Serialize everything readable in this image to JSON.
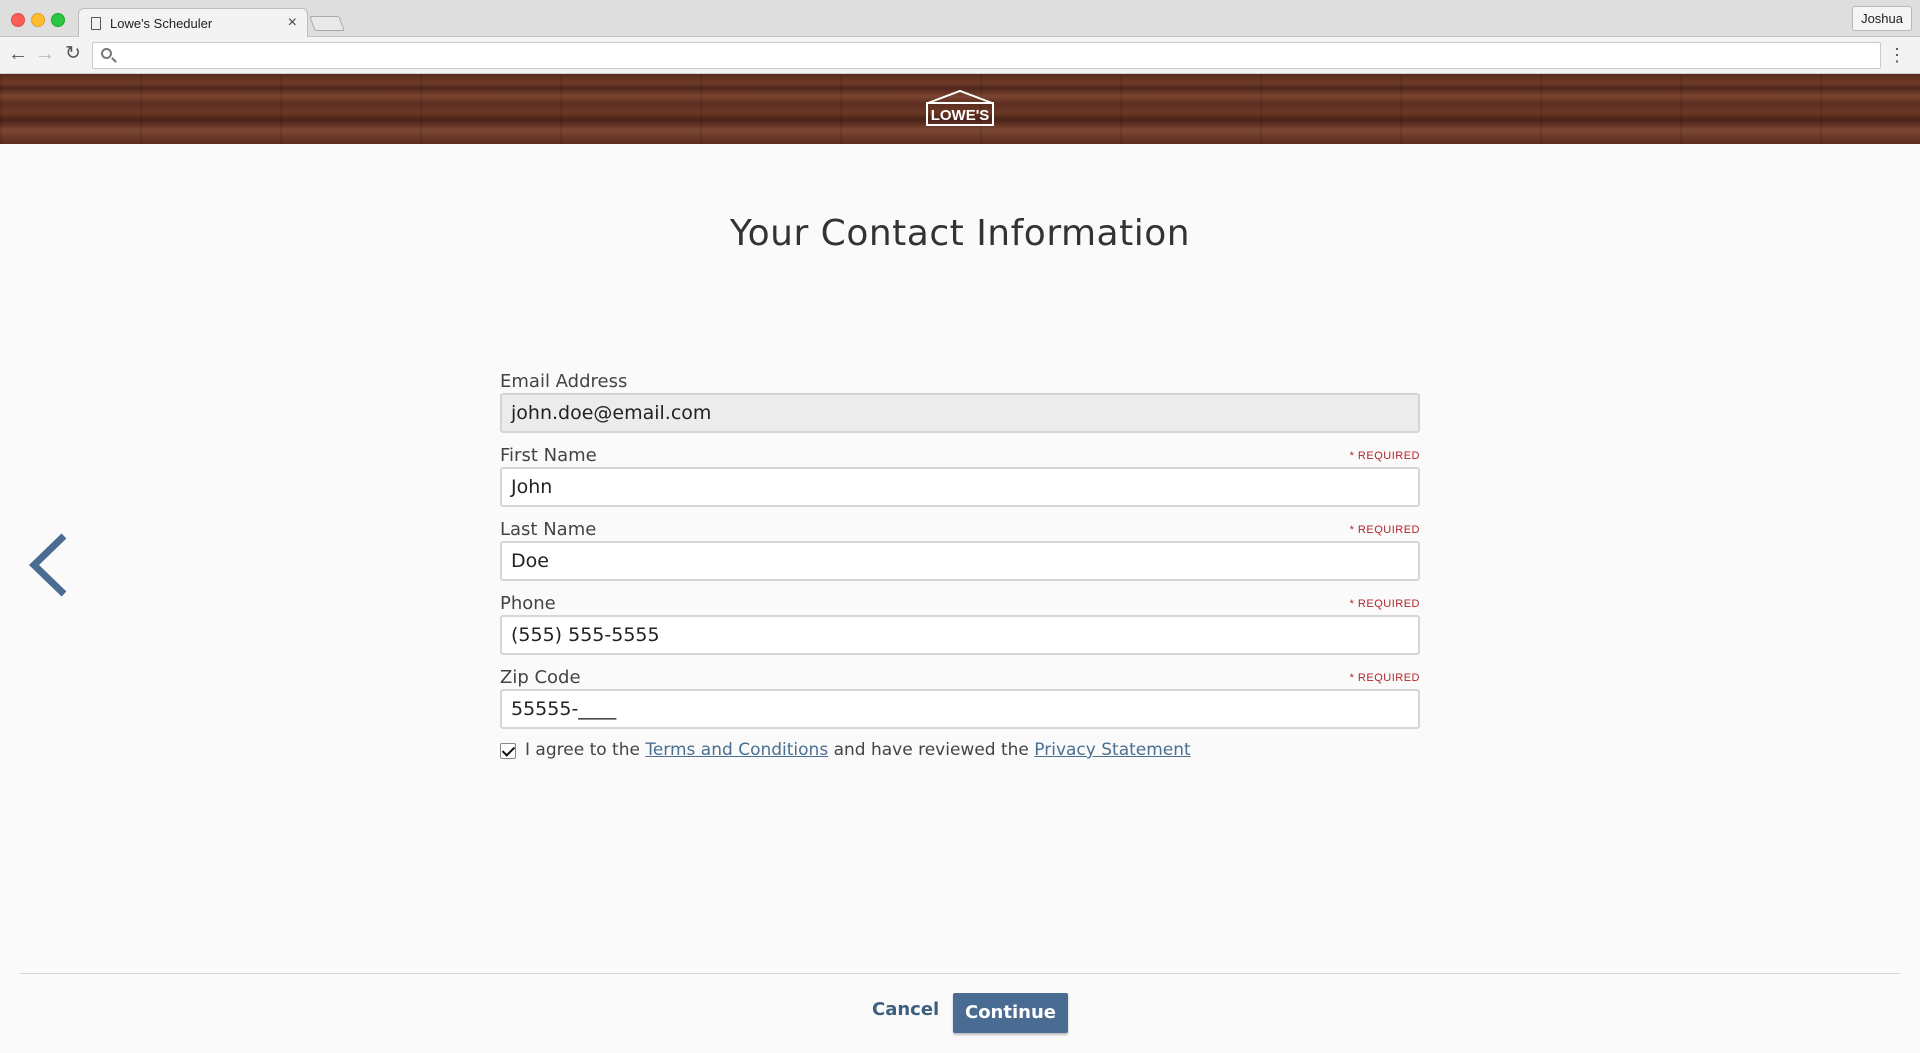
{
  "browser": {
    "tab_title": "Lowe's Scheduler",
    "tab_close": "×",
    "profile_name": "Joshua",
    "address_value": "",
    "nav_back": "←",
    "nav_forward": "→",
    "nav_reload": "↻",
    "menu": "⋮"
  },
  "header": {
    "logo_text": "LOWE'S"
  },
  "page": {
    "title": "Your Contact Information"
  },
  "form": {
    "required_label": "* REQUIRED",
    "fields": [
      {
        "label": "Email Address",
        "value": "john.doe@email.com",
        "required": false,
        "disabled": true
      },
      {
        "label": "First Name",
        "value": "John",
        "required": true,
        "disabled": false
      },
      {
        "label": "Last Name",
        "value": "Doe",
        "required": true,
        "disabled": false
      },
      {
        "label": "Phone",
        "value": "(555) 555-5555",
        "required": true,
        "disabled": false
      },
      {
        "label": "Zip Code",
        "value": "55555-____",
        "required": true,
        "disabled": false
      }
    ],
    "agreement": {
      "checked": true,
      "prefix": "I agree to the ",
      "terms_link": "Terms and Conditions",
      "middle": " and have reviewed the ",
      "privacy_link": "Privacy Statement"
    }
  },
  "footer": {
    "cancel_label": "Cancel",
    "continue_label": "Continue"
  },
  "colors": {
    "accent": "#4a6c93",
    "required": "#b0262a",
    "link": "#4a6f91"
  }
}
